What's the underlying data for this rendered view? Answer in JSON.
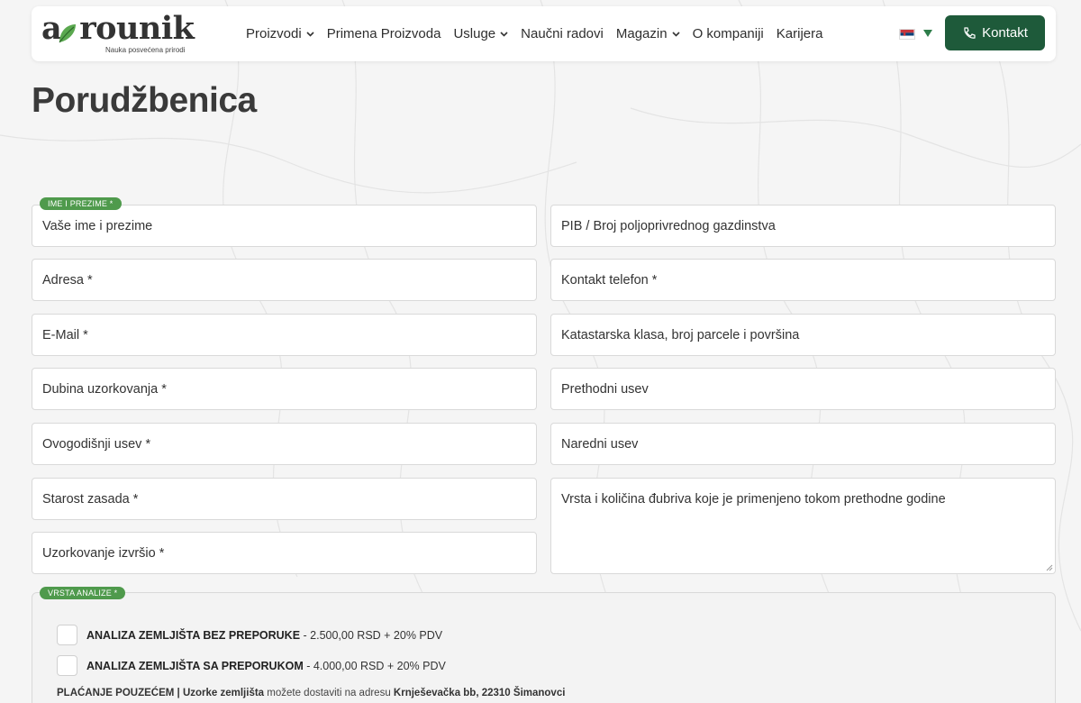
{
  "brand": {
    "logo_text": "agrounik",
    "tagline": "Nauka posvećena prirodi",
    "accent_color": "#4f9a4c",
    "button_color": "#1e5a3a"
  },
  "nav": {
    "items": [
      {
        "label": "Proizvodi",
        "dropdown": true
      },
      {
        "label": "Primena Proizvoda",
        "dropdown": false
      },
      {
        "label": "Usluge",
        "dropdown": true
      },
      {
        "label": "Naučni radovi",
        "dropdown": false
      },
      {
        "label": "Magazin",
        "dropdown": true
      },
      {
        "label": "O kompaniji",
        "dropdown": false
      },
      {
        "label": "Karijera",
        "dropdown": false
      }
    ],
    "language_flag": "serbia-flag-icon",
    "contact_button": "Kontakt"
  },
  "page": {
    "title": "Porudžbenica"
  },
  "form": {
    "name_pill": "IME I PREZIME  *",
    "fields_left": [
      "Vaše ime i prezime",
      "Adresa *",
      "E-Mail *",
      "Dubina uzorkovanja *",
      "Ovogodišnji usev *",
      "Starost zasada *",
      "Uzorkovanje izvršio *"
    ],
    "fields_right": [
      "PIB / Broj poljoprivrednog gazdinstva",
      "Kontakt telefon *",
      "Katastarska klasa, broj parcele i površina",
      "Prethodni usev",
      "Naredni usev",
      "Vrsta i količina đubriva koje je primenjeno tokom prethodne godine"
    ],
    "analysis_pill": "VRSTA ANALIZE  *",
    "options": [
      {
        "name": "ANALIZA ZEMLJIŠTA BEZ PREPORUKE",
        "price": " - 2.500,00 RSD + 20% PDV"
      },
      {
        "name": "ANALIZA ZEMLJIŠTA SA PREPORUKOM",
        "price": " - 4.000,00 RSD + 20% PDV"
      }
    ],
    "note": {
      "part1": "PLAĆANJE POUZEĆEM | Uzorke zemljišta",
      "part2": " možete dostaviti na adresu ",
      "part3": "Krnješevačka bb, 22310 Šimanovci"
    }
  }
}
